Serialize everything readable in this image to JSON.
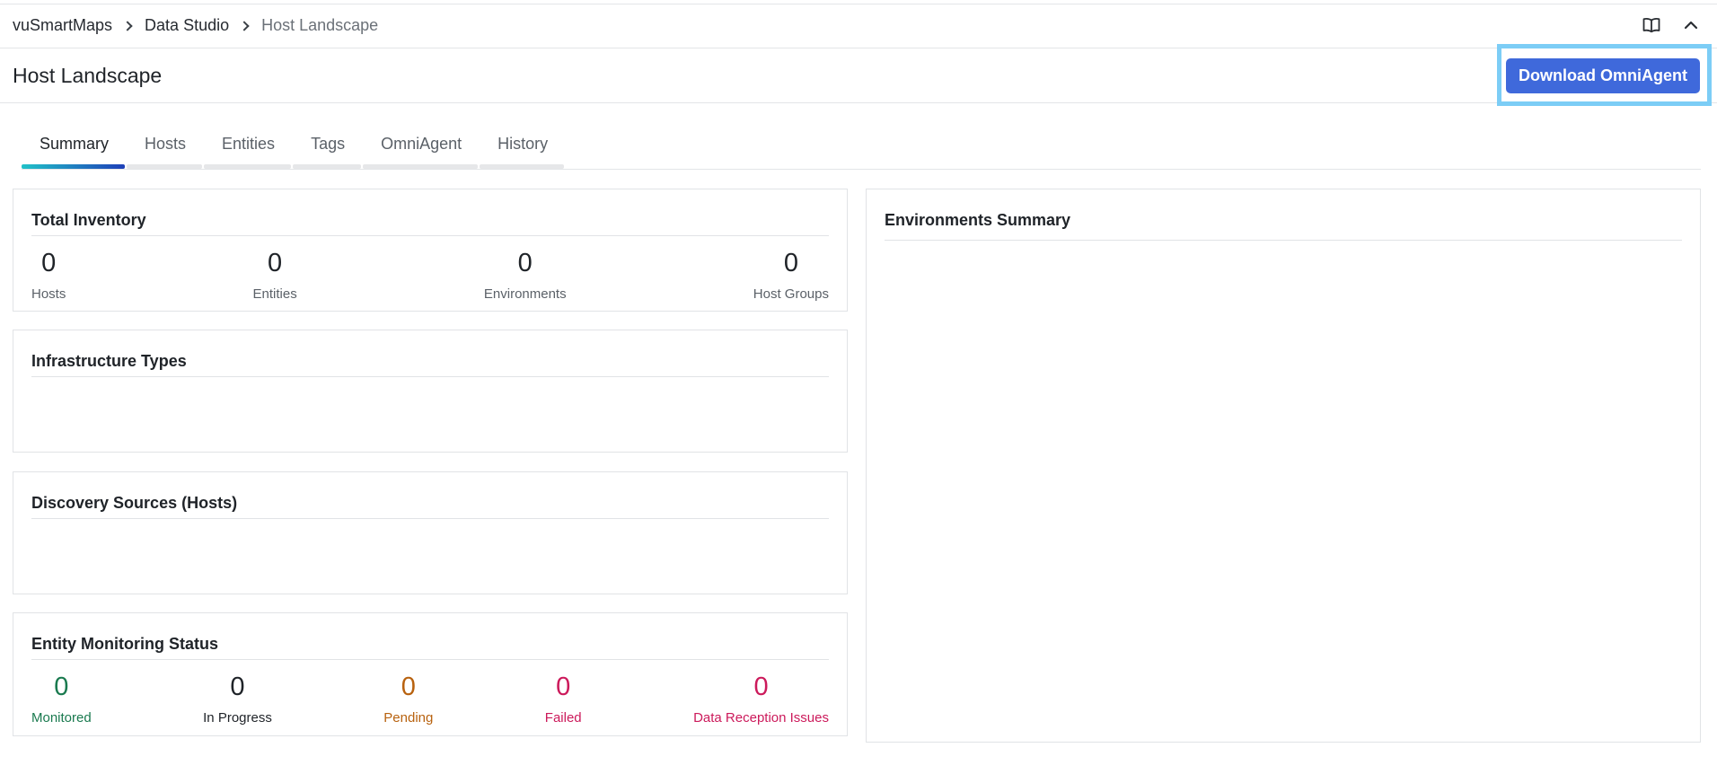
{
  "breadcrumb": {
    "items": [
      "vuSmartMaps",
      "Data Studio",
      "Host Landscape"
    ]
  },
  "topbar": {
    "docs_icon": "book-icon",
    "collapse_icon": "chevron-up-icon"
  },
  "header": {
    "title": "Host Landscape",
    "download_label": "Download OmniAgent"
  },
  "tabs": [
    {
      "label": "Summary",
      "active": true
    },
    {
      "label": "Hosts",
      "active": false
    },
    {
      "label": "Entities",
      "active": false
    },
    {
      "label": "Tags",
      "active": false
    },
    {
      "label": "OmniAgent",
      "active": false
    },
    {
      "label": "History",
      "active": false
    }
  ],
  "total_inventory": {
    "title": "Total Inventory",
    "stats": [
      {
        "value": "0",
        "label": "Hosts"
      },
      {
        "value": "0",
        "label": "Entities"
      },
      {
        "value": "0",
        "label": "Environments"
      },
      {
        "value": "0",
        "label": "Host Groups"
      }
    ]
  },
  "infrastructure_types": {
    "title": "Infrastructure Types"
  },
  "discovery_sources": {
    "title": "Discovery Sources (Hosts)"
  },
  "entity_monitoring": {
    "title": "Entity Monitoring Status",
    "stats": [
      {
        "value": "0",
        "label": "Monitored",
        "color": "#1a7a4f"
      },
      {
        "value": "0",
        "label": "In Progress",
        "color": "#1f2328"
      },
      {
        "value": "0",
        "label": "Pending",
        "color": "#b8620f"
      },
      {
        "value": "0",
        "label": "Failed",
        "color": "#cc1a5b"
      },
      {
        "value": "0",
        "label": "Data Reception Issues",
        "color": "#cc1a5b"
      }
    ]
  },
  "environments_summary": {
    "title": "Environments Summary"
  },
  "colors": {
    "primary": "#3f69db",
    "highlight": "#7ccdf6",
    "tab_gradient_start": "#21c2c8",
    "tab_gradient_end": "#1e3fb8"
  }
}
